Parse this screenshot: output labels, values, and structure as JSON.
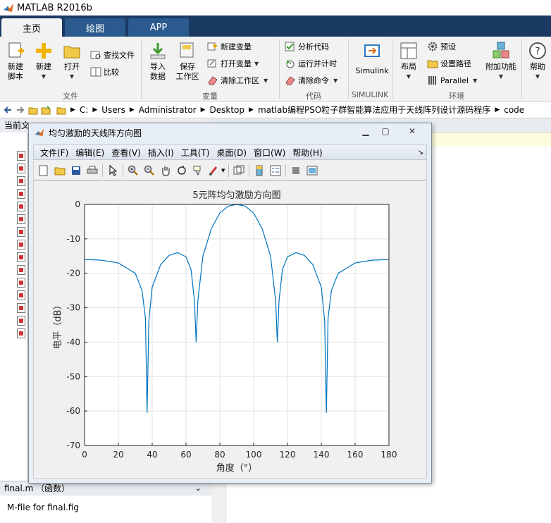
{
  "app": {
    "title": "MATLAB R2016b"
  },
  "tabs": [
    {
      "label": "主页"
    },
    {
      "label": "绘图"
    },
    {
      "label": "APP"
    }
  ],
  "ribbon": {
    "file": {
      "new_script": [
        "新建",
        "脚本"
      ],
      "new": "新建",
      "open": "打开",
      "find_files": "查找文件",
      "compare": "比较",
      "group": "文件"
    },
    "variable": {
      "import": [
        "导入",
        "数据"
      ],
      "save": [
        "保存",
        "工作区"
      ],
      "new_var": "新建变量",
      "open_var": "打开变量",
      "clear_ws": "清除工作区",
      "group": "变量"
    },
    "code": {
      "analyze": "分析代码",
      "run_time": "运行并计时",
      "clear_cmd": "清除命令",
      "group": "代码"
    },
    "simulink": {
      "label": "Simulink",
      "group": "SIMULINK"
    },
    "env": {
      "layout": "布局",
      "prefs": "预设",
      "set_path": "设置路径",
      "parallel": "Parallel",
      "addons": "附加功能",
      "group": "环境"
    },
    "help": {
      "label": "帮助"
    }
  },
  "address": {
    "parts": [
      "C:",
      "Users",
      "Administrator",
      "Desktop",
      "matlab编程PSO粒子群智能算法应用于天线阵列设计源码程序",
      "code"
    ]
  },
  "left_panel": {
    "header": "当前文件夹"
  },
  "details": {
    "title": "final.m （函数）",
    "desc": "M-file for final.fig"
  },
  "figure": {
    "title": "均匀激励的天线阵方向图",
    "menu": [
      "文件(F)",
      "编辑(E)",
      "查看(V)",
      "插入(I)",
      "工具(T)",
      "桌面(D)",
      "窗口(W)",
      "帮助(H)"
    ]
  },
  "chart_data": {
    "type": "line",
    "title": "5元阵均匀激励方向图",
    "xlabel": "角度（°）",
    "ylabel": "电平（dB）",
    "xlim": [
      0,
      180
    ],
    "ylim": [
      -70,
      0
    ],
    "xticks": [
      0,
      20,
      40,
      60,
      80,
      100,
      120,
      140,
      160,
      180
    ],
    "yticks": [
      0,
      -10,
      -20,
      -30,
      -40,
      -50,
      -60,
      -70
    ],
    "grid": true,
    "series": [
      {
        "color": "#0072bd",
        "x": [
          0,
          10,
          20,
          30,
          34,
          36,
          37,
          38,
          40,
          45,
          50,
          55,
          60,
          63,
          65,
          66,
          67,
          70,
          75,
          80,
          85,
          90,
          95,
          100,
          105,
          110,
          113,
          114,
          115,
          117,
          120,
          125,
          130,
          135,
          140,
          142,
          143,
          144,
          146,
          150,
          160,
          170,
          180
        ],
        "y": [
          -16,
          -16.2,
          -17,
          -20,
          -25,
          -33,
          -60.5,
          -34,
          -24,
          -17.5,
          -14.8,
          -14,
          -15.2,
          -19,
          -28,
          -40,
          -28,
          -15,
          -7,
          -2.5,
          -0.5,
          0,
          -0.5,
          -2.5,
          -7,
          -15,
          -28,
          -40,
          -28,
          -19,
          -15.2,
          -14,
          -14.8,
          -17.5,
          -24,
          -34,
          -60.5,
          -33,
          -25,
          -20,
          -17,
          -16.2,
          -16
        ]
      }
    ]
  }
}
